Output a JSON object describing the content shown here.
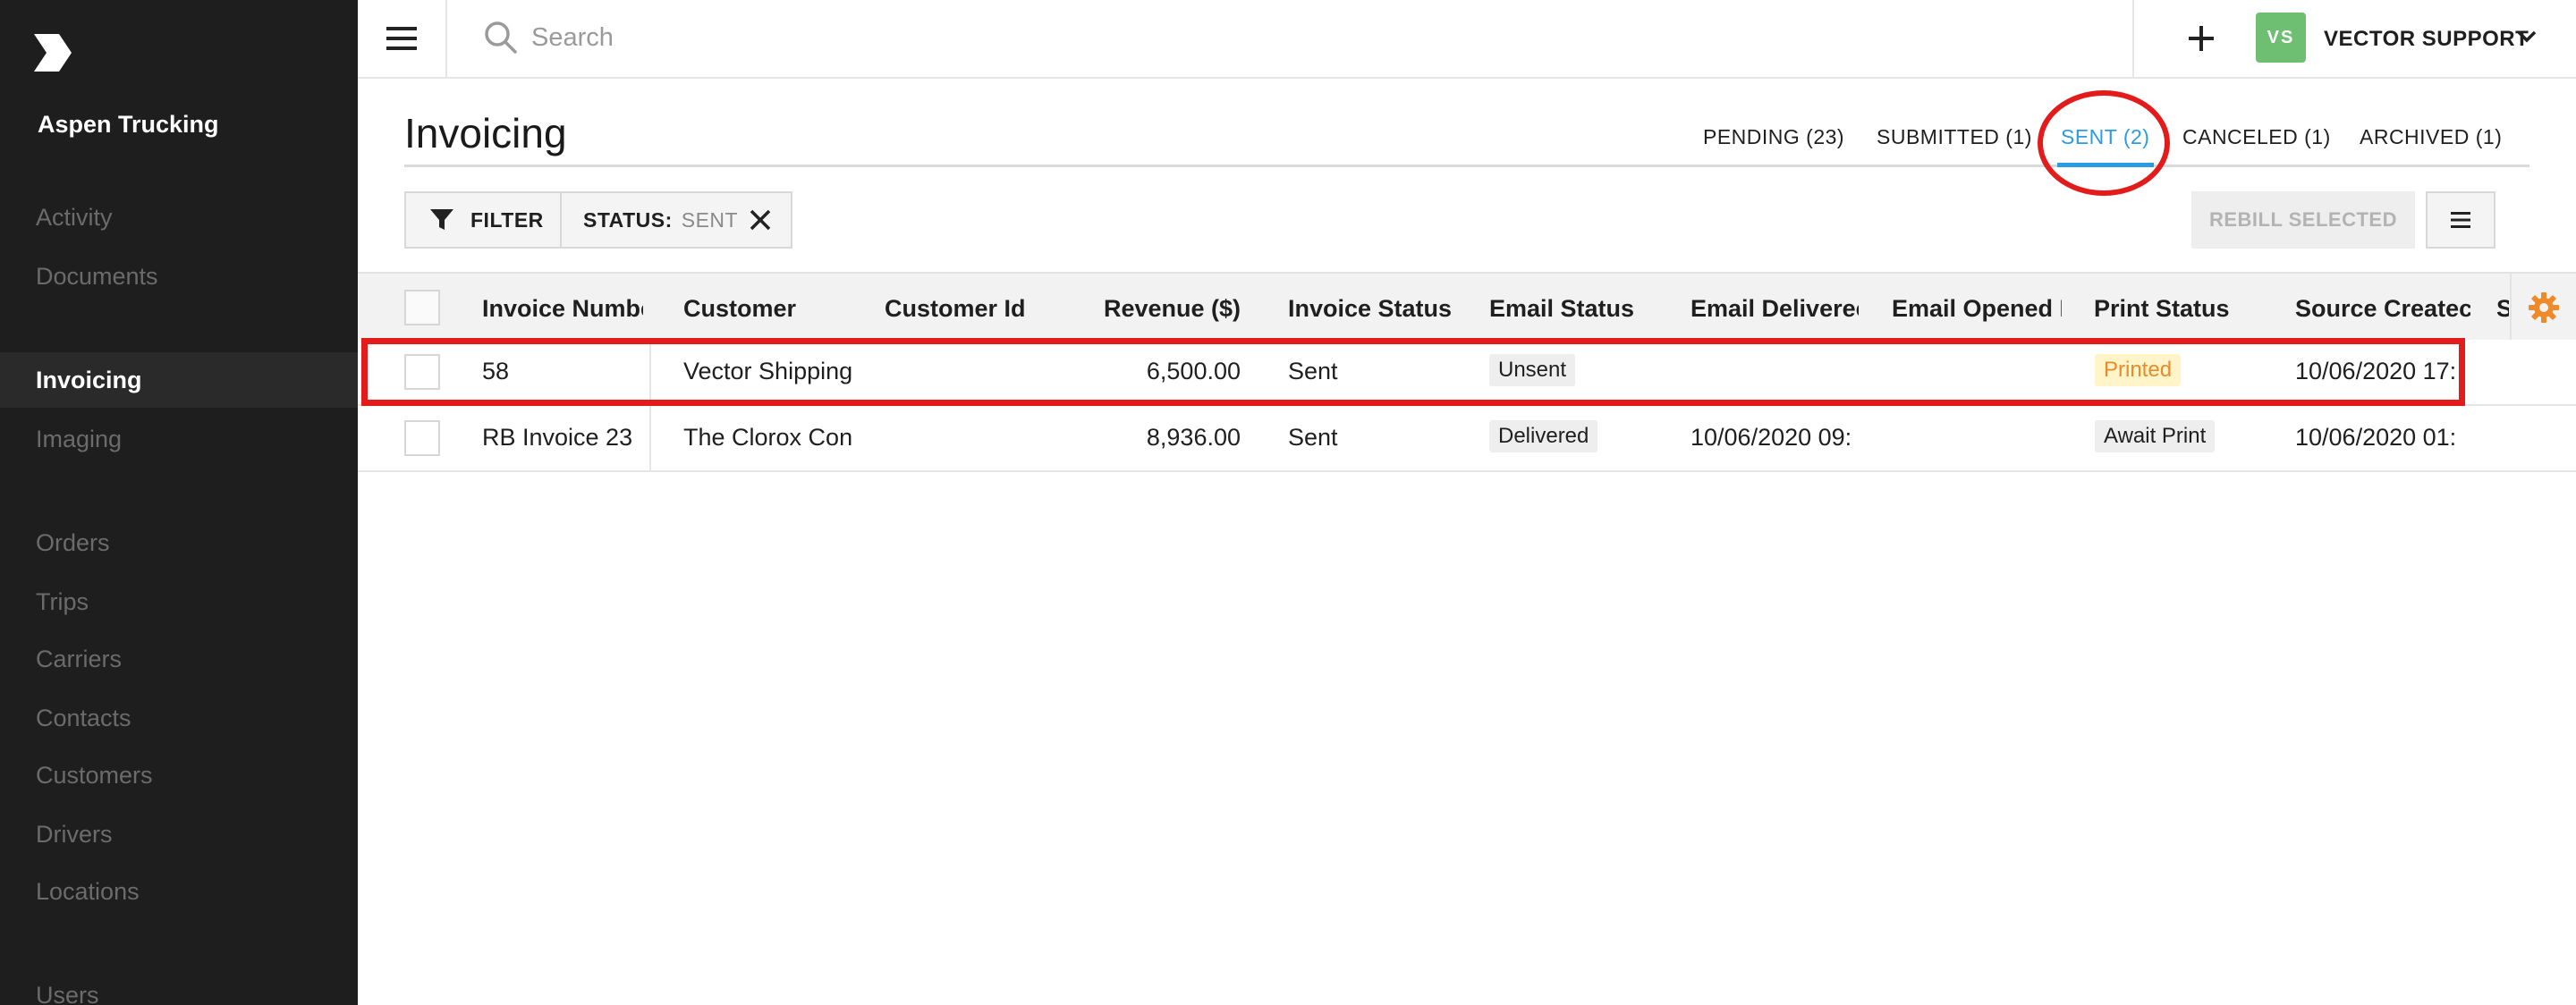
{
  "sidebar": {
    "org_name": "Aspen Trucking",
    "items": [
      {
        "label": "Activity"
      },
      {
        "label": "Documents"
      },
      {
        "label": "Invoicing"
      },
      {
        "label": "Imaging"
      },
      {
        "label": "Orders"
      },
      {
        "label": "Trips"
      },
      {
        "label": "Carriers"
      },
      {
        "label": "Contacts"
      },
      {
        "label": "Customers"
      },
      {
        "label": "Drivers"
      },
      {
        "label": "Locations"
      },
      {
        "label": "Users"
      }
    ],
    "active_item": "Invoicing"
  },
  "topbar": {
    "search_placeholder": "Search",
    "user_initials": "VS",
    "user_name": "VECTOR SUPPORT",
    "avatar_color": "#6fbf73"
  },
  "page": {
    "title": "Invoicing",
    "tabs": [
      {
        "label": "PENDING (23)"
      },
      {
        "label": "SUBMITTED (1)"
      },
      {
        "label": "SENT (2)"
      },
      {
        "label": "CANCELED (1)"
      },
      {
        "label": "ARCHIVED (1)"
      }
    ],
    "active_tab": "SENT (2)",
    "accent_color": "#2b9be4"
  },
  "toolbar": {
    "filter_label": "FILTER",
    "status_key": "STATUS:",
    "status_value": "SENT",
    "rebill_label": "REBILL SELECTED"
  },
  "table": {
    "columns": [
      "Invoice Numbe",
      "Customer",
      "Customer Id",
      "Revenue ($)",
      "Invoice Status",
      "Email Status",
      "Email Deliverec",
      "Email Opened I",
      "Print Status",
      "Source Createc",
      "S"
    ],
    "rows": [
      {
        "invoice_number": "58",
        "customer": "Vector Shipping",
        "customer_id": "",
        "revenue": "6,500.00",
        "invoice_status": "Sent",
        "email_status": "Unsent",
        "email_delivered": "",
        "email_opened": "",
        "print_status": "Printed",
        "source_created": "10/06/2020 17:"
      },
      {
        "invoice_number": "RB Invoice 23",
        "customer": "The Clorox Con",
        "customer_id": "",
        "revenue": "8,936.00",
        "invoice_status": "Sent",
        "email_status": "Delivered",
        "email_delivered": "10/06/2020 09:",
        "email_opened": "",
        "print_status": "Await Print",
        "source_created": "10/06/2020 01:"
      }
    ]
  },
  "annotation_color": "#e31b1b"
}
